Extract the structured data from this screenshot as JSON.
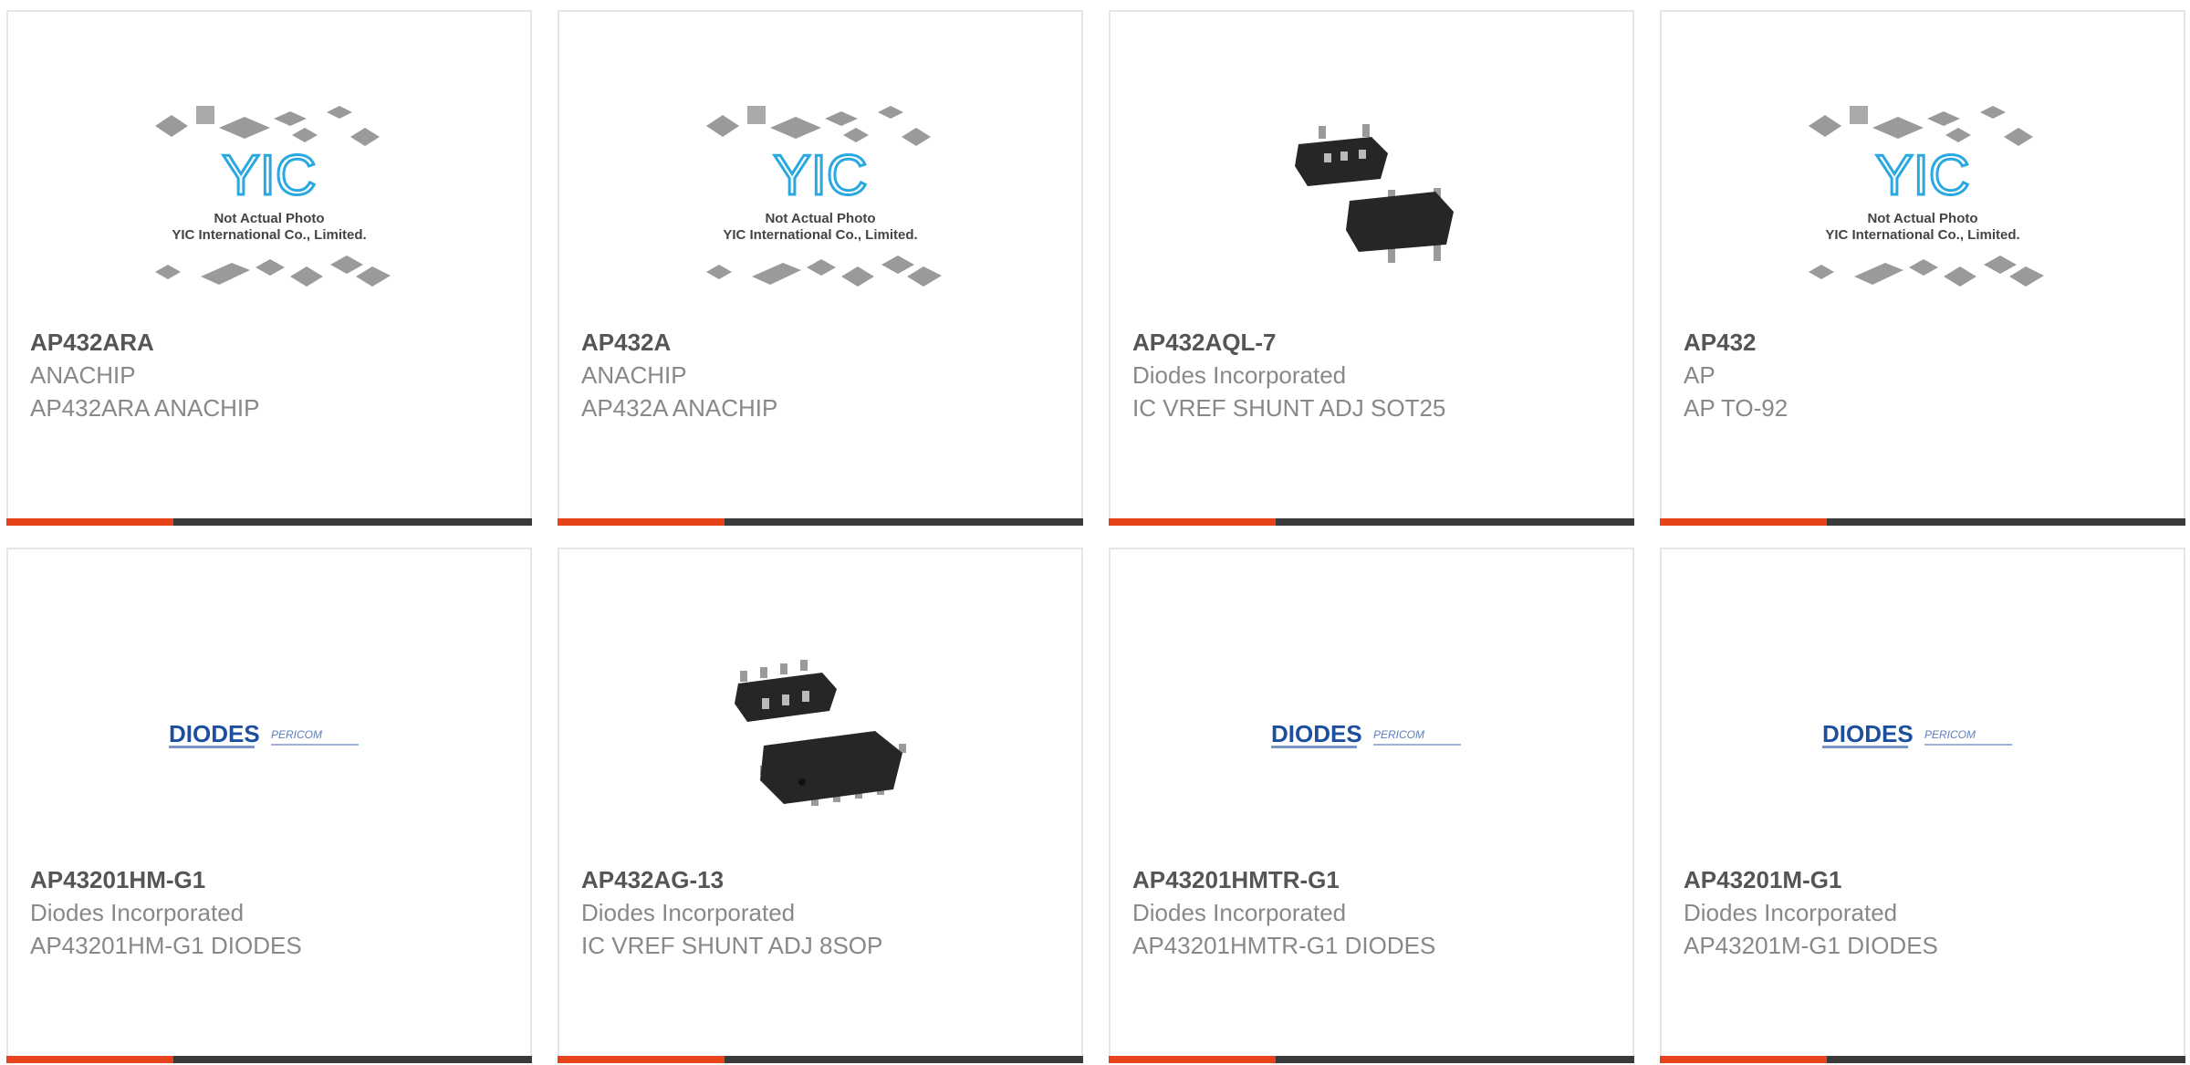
{
  "accent_color": "#e8421b",
  "bar_color": "#3a3a3a",
  "products": [
    {
      "part_number": "AP432ARA",
      "manufacturer": "ANACHIP",
      "description": "AP432ARA ANACHIP",
      "image": "yic-placeholder-image",
      "placeholder_line1": "Not Actual Photo",
      "placeholder_line2": "YIC International Co., Limited.",
      "logo_text": "YIC"
    },
    {
      "part_number": "AP432A",
      "manufacturer": "ANACHIP",
      "description": "AP432A ANACHIP",
      "image": "yic-placeholder-image",
      "placeholder_line1": "Not Actual Photo",
      "placeholder_line2": "YIC International Co., Limited.",
      "logo_text": "YIC"
    },
    {
      "part_number": "AP432AQL-7",
      "manufacturer": "Diodes Incorporated",
      "description": "IC VREF SHUNT ADJ SOT25",
      "image": "sot25-chip-photo"
    },
    {
      "part_number": "AP432",
      "manufacturer": "AP",
      "description": "AP TO-92",
      "image": "yic-placeholder-image",
      "placeholder_line1": "Not Actual Photo",
      "placeholder_line2": "YIC International Co., Limited.",
      "logo_text": "YIC"
    },
    {
      "part_number": "AP43201HM-G1",
      "manufacturer": "Diodes Incorporated",
      "description": "AP43201HM-G1 DIODES",
      "image": "diodes-pericom-logo",
      "logo_text": "DIODES",
      "logo_text2": "PERICOM"
    },
    {
      "part_number": "AP432AG-13",
      "manufacturer": "Diodes Incorporated",
      "description": "IC VREF SHUNT ADJ 8SOP",
      "image": "8sop-chip-photo"
    },
    {
      "part_number": "AP43201HMTR-G1",
      "manufacturer": "Diodes Incorporated",
      "description": "AP43201HMTR-G1 DIODES",
      "image": "diodes-pericom-logo",
      "logo_text": "DIODES",
      "logo_text2": "PERICOM"
    },
    {
      "part_number": "AP43201M-G1",
      "manufacturer": "Diodes Incorporated",
      "description": "AP43201M-G1 DIODES",
      "image": "diodes-pericom-logo",
      "logo_text": "DIODES",
      "logo_text2": "PERICOM"
    }
  ]
}
